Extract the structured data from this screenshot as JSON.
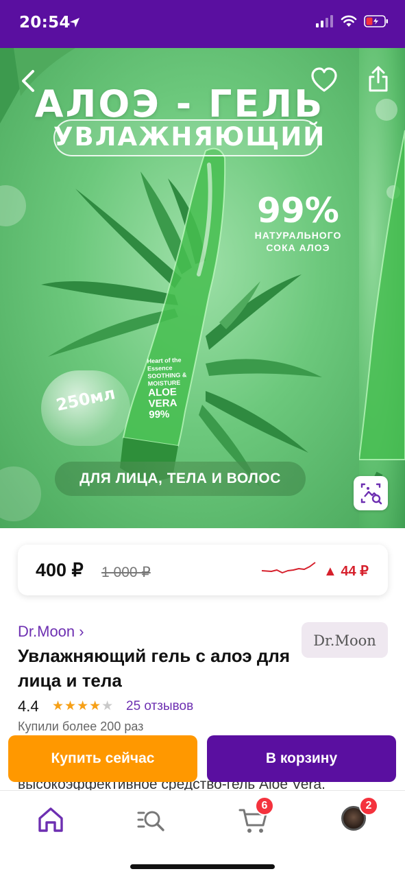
{
  "status_bar": {
    "time": "20:54"
  },
  "promo": {
    "title": "АЛОЭ - ГЕЛЬ",
    "subtitle": "УВЛАЖНЯЮЩИЙ",
    "percent": "99%",
    "percent_caption_line1": "НАТУРАЛЬНОГО",
    "percent_caption_line2": "СОКА АЛОЭ",
    "volume": "250мл",
    "banner": "ДЛЯ ЛИЦА, ТЕЛА И ВОЛОС",
    "bottle_small_1": "Heart of the Essence",
    "bottle_small_2": "SOOTHING & MOISTURE",
    "bottle_big": "ALOE VERA",
    "bottle_percent": "99%"
  },
  "price": {
    "current": "400 ₽",
    "old": "1 000 ₽",
    "change": "▲ 44 ₽",
    "colors": {
      "trend": "#d6202c"
    }
  },
  "product": {
    "brand": "Dr.Moon ›",
    "brand_logo": "Dr.Moon",
    "title": "Увлажняющий гель с алоэ для лица и тела",
    "rating": "4.4",
    "rating_value": 4.4,
    "stars_full": "★★★★",
    "stars_half": "★",
    "reviews": "25 отзывов",
    "bought": "Купили более 200 раз",
    "description": "высокоэффективное средство-гель Aloe Vera."
  },
  "actions": {
    "buy_now": "Купить сейчас",
    "add_to_cart": "В корзину"
  },
  "tab_bar": {
    "cart_badge": "6",
    "profile_badge": "2"
  },
  "icons": {
    "back": "chevron-left-icon",
    "favorite": "heart-icon",
    "share": "share-icon",
    "image_search": "image-search-icon",
    "home": "home-icon",
    "catalog": "search-list-icon",
    "cart": "cart-icon",
    "profile": "avatar"
  },
  "colors": {
    "brand_purple": "#5a0fa0",
    "buy_orange": "#ff9800",
    "link_purple": "#6d2fb1",
    "star": "#f6a017",
    "badge_red": "#f4323d"
  }
}
